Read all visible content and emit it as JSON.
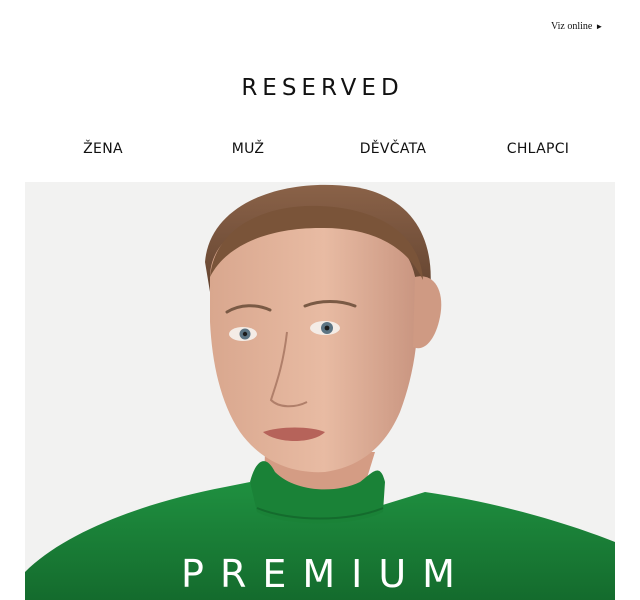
{
  "header": {
    "view_online_label": "Viz online",
    "view_online_arrow": "►"
  },
  "brand": {
    "logo_text": "RESERVED"
  },
  "nav": {
    "items": [
      {
        "label": "ŽENA"
      },
      {
        "label": "MUŽ"
      },
      {
        "label": "DĚVČATA"
      },
      {
        "label": "CHLAPCI"
      }
    ]
  },
  "hero": {
    "headline": "PREMIUM",
    "background_color": "#f2f2f1",
    "sweater_color": "#1e8a3a"
  }
}
